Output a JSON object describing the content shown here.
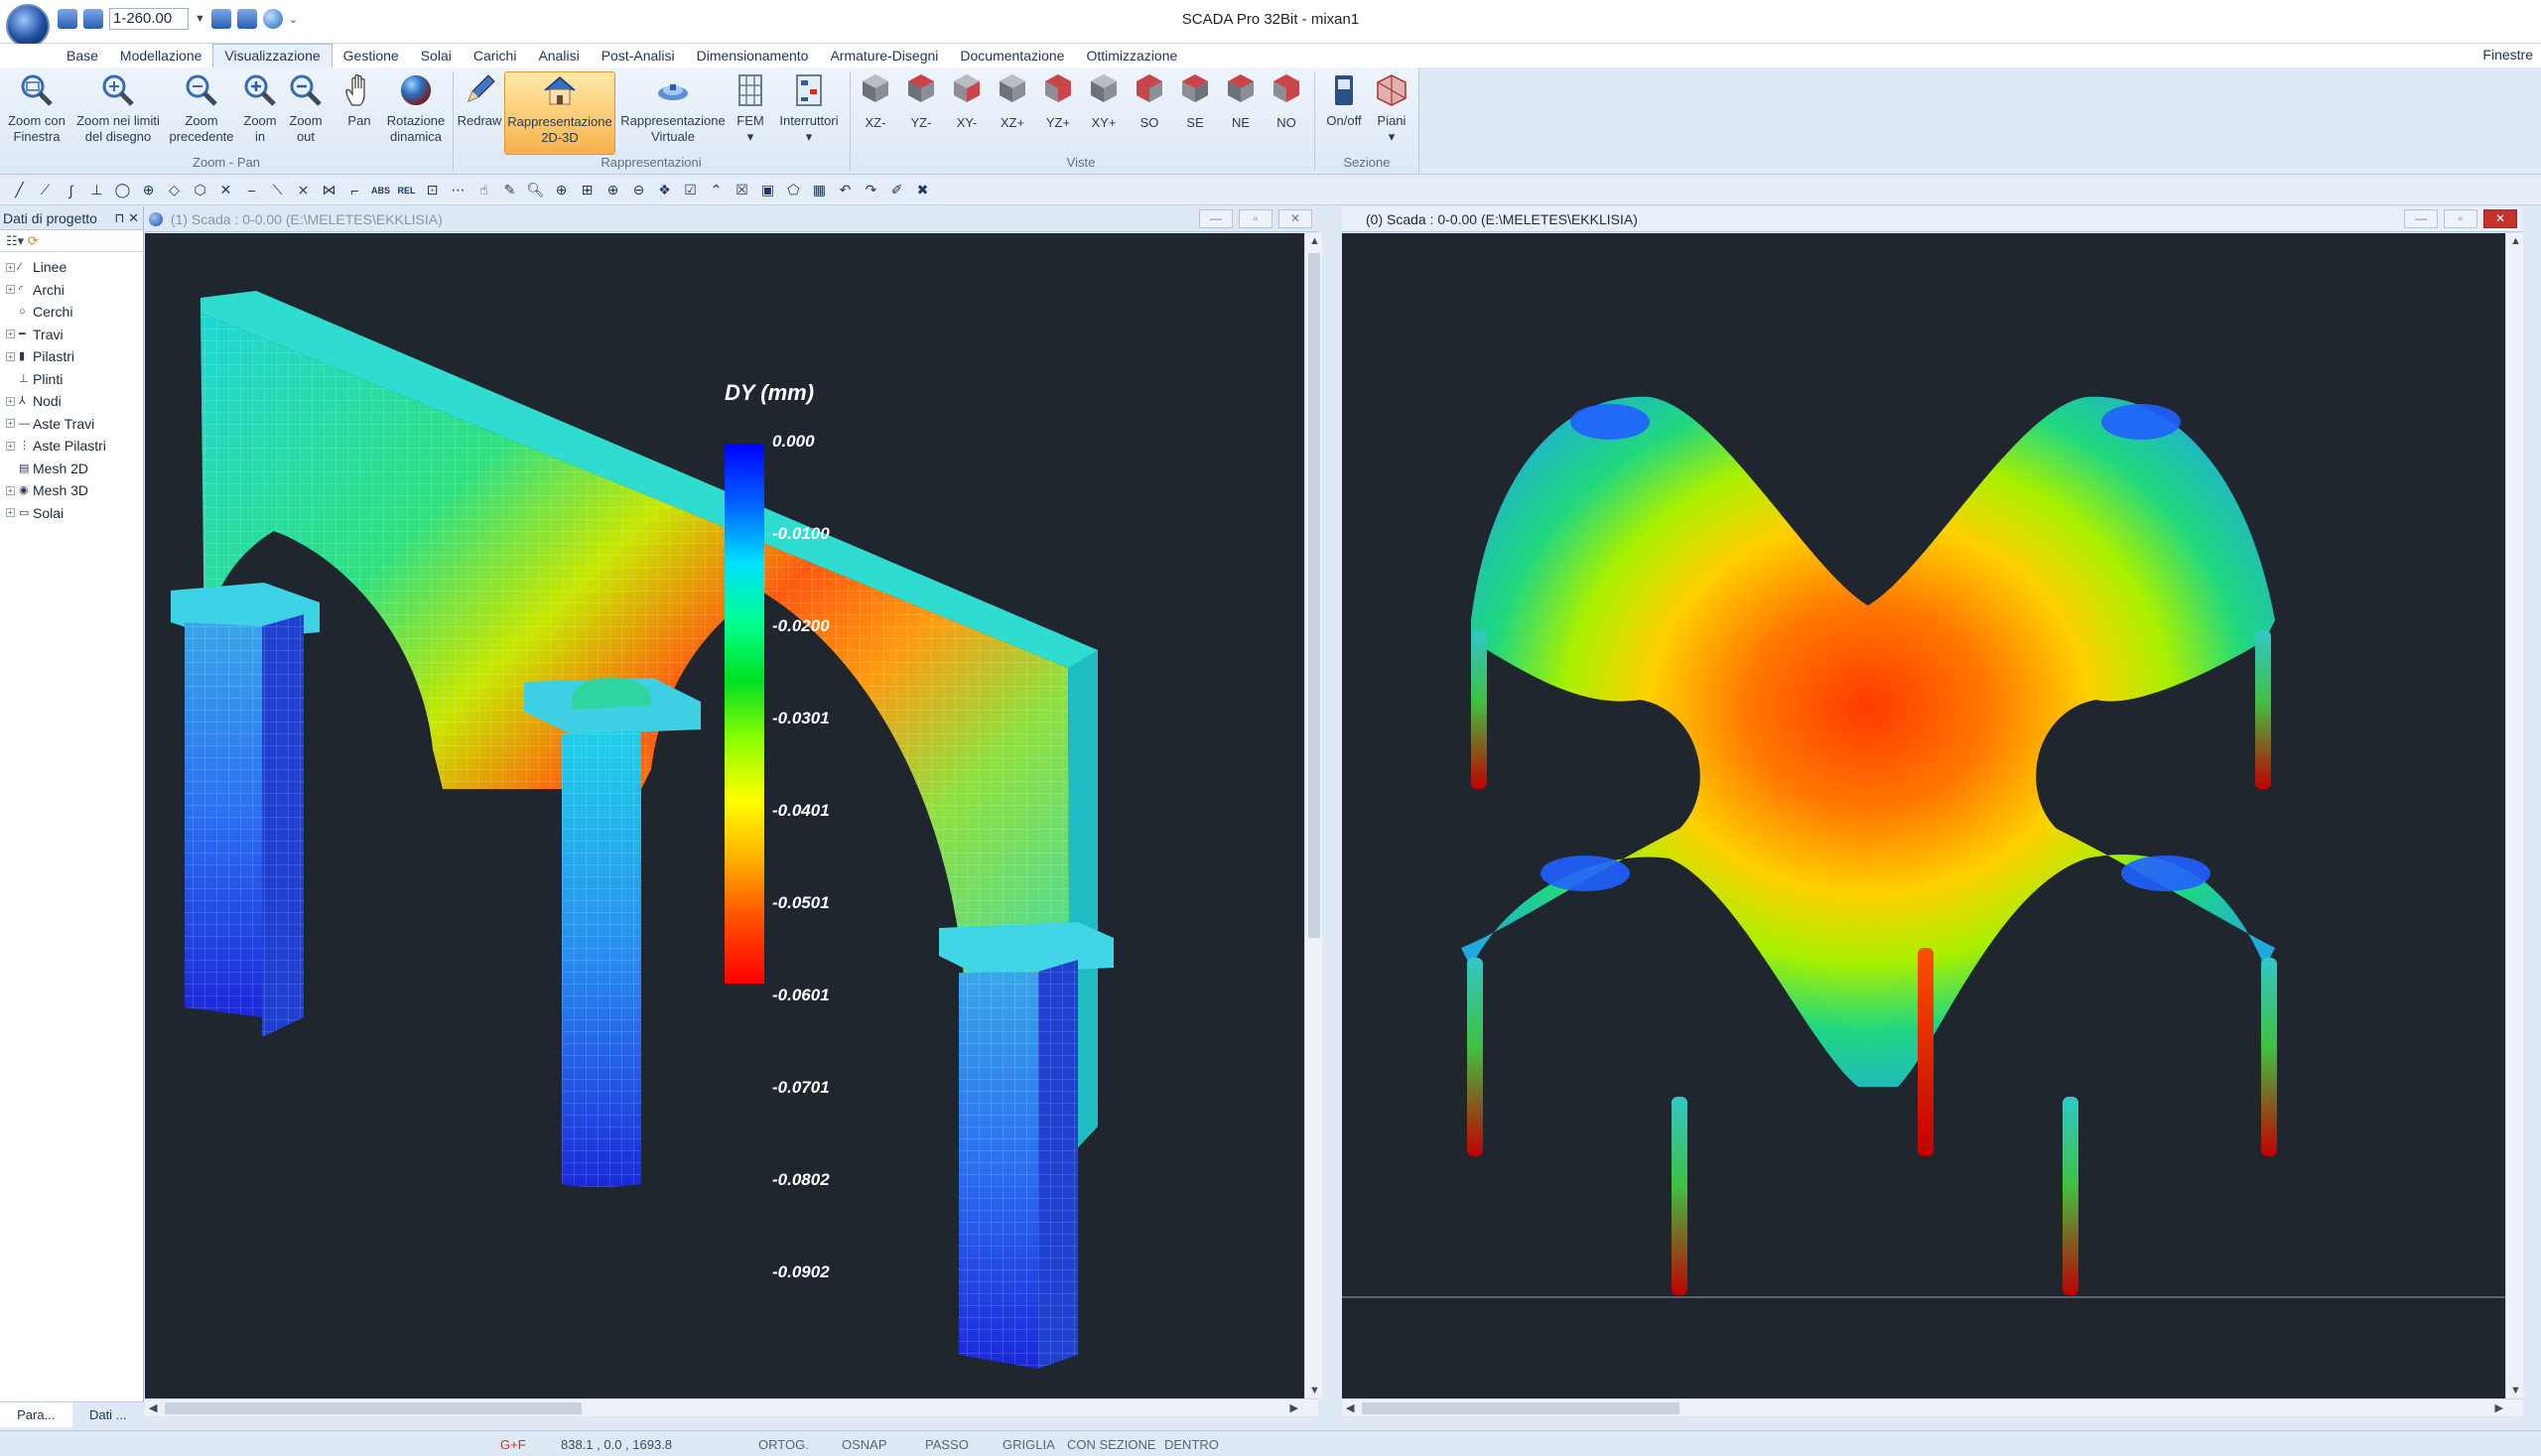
{
  "title_bar": {
    "window_title": "SCADA Pro 32Bit - mixan1",
    "scale_value": "1-260.00"
  },
  "menu": {
    "tabs": [
      "Base",
      "Modellazione",
      "Visualizzazione",
      "Gestione",
      "Solai",
      "Carichi",
      "Analisi",
      "Post-Analisi",
      "Dimensionamento",
      "Armature-Disegni",
      "Documentazione",
      "Ottimizzazione"
    ],
    "active": "Visualizzazione",
    "right_label": "Finestre"
  },
  "ribbon": {
    "zoom_pan": {
      "group_label": "Zoom - Pan",
      "buttons": [
        {
          "line1": "Zoom con",
          "line2": "Finestra",
          "icon": "zoom-window-icon"
        },
        {
          "line1": "Zoom nei limiti",
          "line2": "del disegno",
          "icon": "zoom-extents-icon"
        },
        {
          "line1": "Zoom",
          "line2": "precedente",
          "icon": "zoom-previous-icon"
        },
        {
          "line1": "Zoom",
          "line2": "in",
          "icon": "zoom-in-icon"
        },
        {
          "line1": "Zoom",
          "line2": "out",
          "icon": "zoom-out-icon"
        },
        {
          "line1": "Pan",
          "line2": "",
          "icon": "pan-hand-icon"
        },
        {
          "line1": "Rotazione",
          "line2": "dinamica",
          "icon": "dynamic-rotation-icon"
        }
      ]
    },
    "rappresentazioni": {
      "group_label": "Rappresentazioni",
      "buttons": [
        {
          "line1": "Redraw",
          "line2": "",
          "icon": "redraw-pencil-icon"
        },
        {
          "line1": "Rappresentazione",
          "line2": "2D-3D",
          "icon": "house-3d-icon"
        },
        {
          "line1": "Rappresentazione",
          "line2": "Virtuale",
          "icon": "virtual-render-icon"
        },
        {
          "line1": "FEM",
          "line2": "",
          "icon": "fem-mesh-icon"
        },
        {
          "line1": "Interruttori",
          "line2": "",
          "icon": "switches-icon"
        }
      ]
    },
    "viste": {
      "group_label": "Viste",
      "buttons": [
        "XZ-",
        "YZ-",
        "XY-",
        "XZ+",
        "YZ+",
        "XY+",
        "SO",
        "SE",
        "NE",
        "NO"
      ]
    },
    "sezione": {
      "group_label": "Sezione",
      "buttons": [
        {
          "line1": "On/off",
          "icon": "section-toggle-icon"
        },
        {
          "line1": "Piani",
          "icon": "planes-icon"
        }
      ]
    }
  },
  "toolbar_small": {
    "abs_label": "ABS",
    "rel_label": "REL"
  },
  "project_panel": {
    "title": "Dati di progetto",
    "items": [
      "Linee",
      "Archi",
      "Cerchi",
      "Travi",
      "Pilastri",
      "Plinti",
      "Nodi",
      "Aste Travi",
      "Aste Pilastri",
      "Mesh 2D",
      "Mesh 3D",
      "Solai"
    ],
    "tabs": [
      "Para...",
      "Dati ..."
    ]
  },
  "view_left": {
    "title": "(1) Scada : 0-0.00 (E:\\MELETES\\EKKLISIA)"
  },
  "view_right": {
    "title": "(0) Scada : 0-0.00 (E:\\MELETES\\EKKLISIA)"
  },
  "legend": {
    "title": "DY (mm)",
    "ticks": [
      "0.000",
      "-0.0100",
      "-0.0200",
      "-0.0301",
      "-0.0401",
      "-0.0501",
      "-0.0601",
      "-0.0701",
      "-0.0802",
      "-0.0902"
    ],
    "colors": [
      "#0000ff",
      "#00b4ff",
      "#00ffff",
      "#00ff80",
      "#00d000",
      "#c8ff00",
      "#ffff00",
      "#ffb000",
      "#ff6000",
      "#ff0000"
    ]
  },
  "status_bar": {
    "mode": "G+F",
    "coords": "838.1 , 0.0 , 1693.8",
    "toggles": [
      "ORTOG.",
      "OSNAP",
      "PASSO",
      "GRIGLIA",
      "CON SEZIONE",
      "DENTRO"
    ]
  }
}
